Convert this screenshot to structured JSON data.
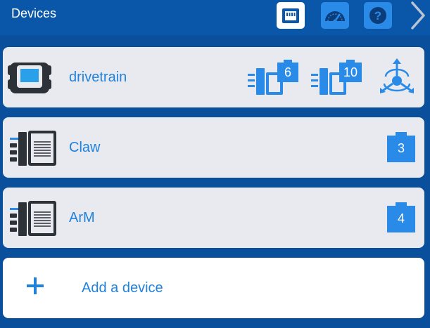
{
  "header": {
    "title": "Devices",
    "buttons": [
      {
        "name": "devices",
        "icon": "devices-port-icon",
        "active": true
      },
      {
        "name": "dashboard",
        "icon": "dashboard-gauge-icon",
        "active": false
      },
      {
        "name": "help",
        "icon": "help-icon",
        "active": false
      }
    ],
    "next_icon": "chevron-right-icon"
  },
  "devices": [
    {
      "name": "drivetrain",
      "icon": "brain-icon",
      "ports": [
        "6",
        "10"
      ],
      "extra_icon": "gyro-sensor-icon"
    },
    {
      "name": "Claw",
      "icon": "motor-icon",
      "ports": [
        "3"
      ]
    },
    {
      "name": "ArM",
      "icon": "motor-icon",
      "ports": [
        "4"
      ]
    }
  ],
  "add_device": {
    "label": "Add a device",
    "icon": "plus-icon"
  },
  "colors": {
    "header": "#0a56a8",
    "background": "#0a4f9c",
    "card": "#e8eaf0",
    "accent": "#2182dc",
    "badge": "#2a8ae8"
  }
}
